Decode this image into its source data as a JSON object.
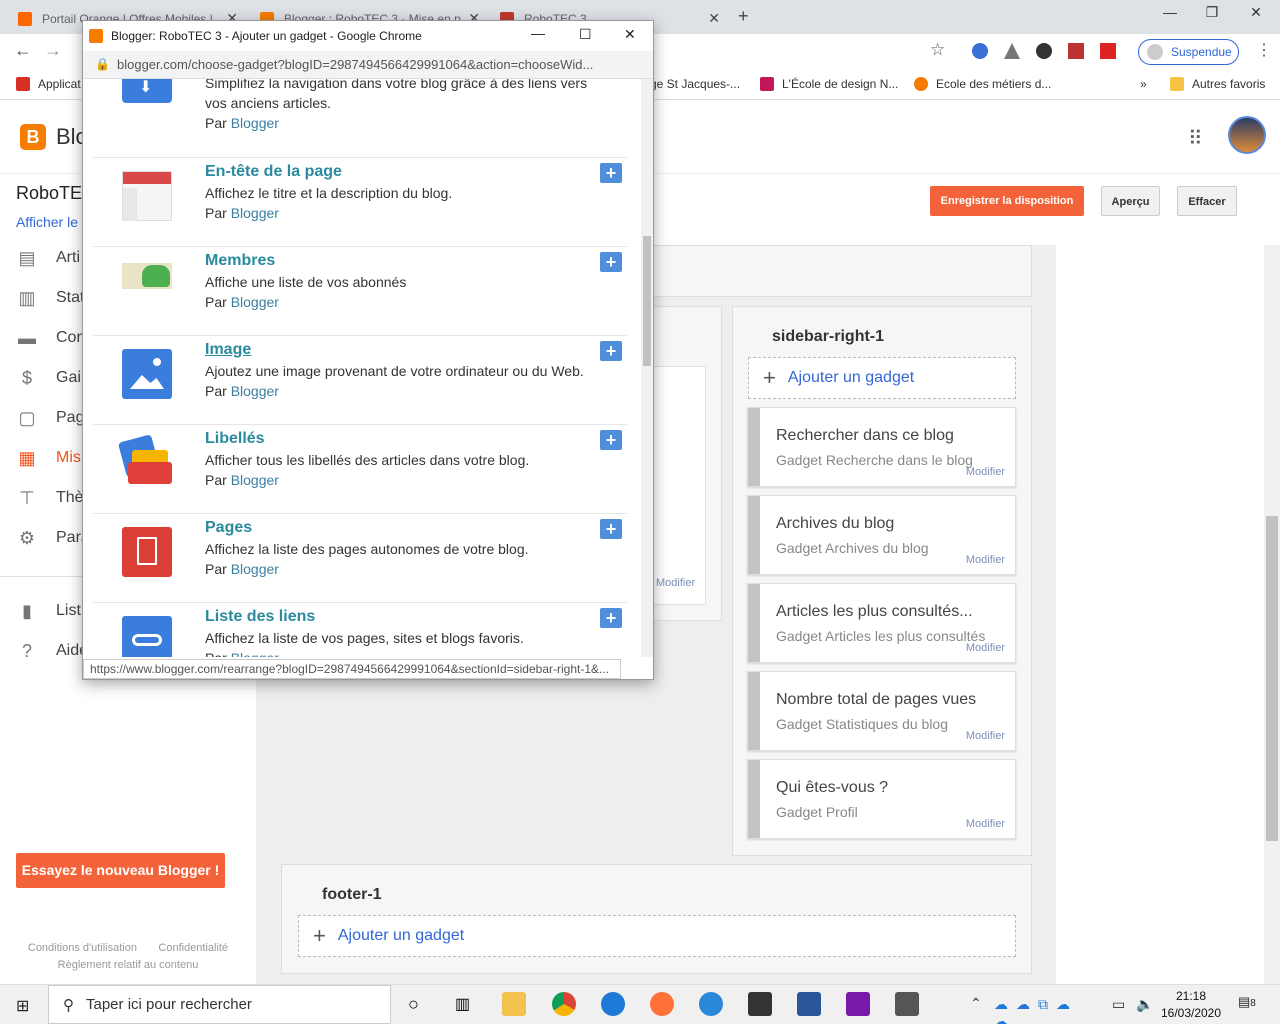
{
  "browser": {
    "tabs": [
      {
        "label": "Portail Orange | Offres Mobiles | ",
        "color": "#ff6600"
      },
      {
        "label": "Blogger : RoboTEC 3 - Mise en p",
        "color": "#f57d00"
      },
      {
        "label": "RoboTEC 3",
        "color": "#c0392b"
      }
    ],
    "profile": "Suspendue",
    "bookmarks": [
      "Applicat",
      "ge St Jacques-...",
      "L'École de design N...",
      "Ecole des métiers d...",
      "»",
      "Autres favoris"
    ]
  },
  "blogger": {
    "brand": "Blo",
    "blog_title": "RoboTEC",
    "view_blog": "Afficher le",
    "nav": [
      "Arti",
      "Stat",
      "Com",
      "Gain",
      "Pag",
      "Mis",
      "Thè",
      "Para",
      "List",
      "Aide"
    ],
    "try_new": "Essayez le nouveau Blogger !",
    "footer": {
      "terms": "Conditions d'utilisation",
      "privacy": "Confidentialité",
      "content": "Règlement relatif au contenu"
    },
    "buttons": {
      "save": "Enregistrer la disposition",
      "preview": "Aperçu",
      "clear": "Effacer"
    },
    "sidebar_title": "sidebar-right-1",
    "footer_title": "footer-1",
    "add_gadget": "Ajouter un gadget",
    "modify": "Modifier",
    "gadgets": [
      {
        "title": "Rechercher dans ce blog",
        "sub": "Gadget Recherche dans le blog"
      },
      {
        "title": "Archives du blog",
        "sub": "Gadget Archives du blog"
      },
      {
        "title": "Articles les plus consultés...",
        "sub": "Gadget Articles les plus consultés"
      },
      {
        "title": "Nombre total de pages vues",
        "sub": "Gadget Statistiques du blog"
      },
      {
        "title": "Qui êtes-vous ?",
        "sub": "Gadget Profil"
      }
    ]
  },
  "popup": {
    "title": "Blogger: RoboTEC 3 - Ajouter un gadget - Google Chrome",
    "url": "blogger.com/choose-gadget?blogID=2987494566429991064&action=chooseWid...",
    "partial_top": {
      "desc1": "Simplifiez la navigation dans votre blog grâce à des liens vers",
      "desc2": "vos anciens articles.",
      "by": "Par"
    },
    "by_label": "Par",
    "author": "Blogger",
    "items": [
      {
        "name": "En-tête de la page",
        "desc": "Affichez le titre et la description du blog."
      },
      {
        "name": "Membres",
        "desc": "Affiche une liste de vos abonnés"
      },
      {
        "name": "Image",
        "desc": "Ajoutez une image provenant de votre ordinateur ou du Web."
      },
      {
        "name": "Libellés",
        "desc": "Afficher tous les libellés des articles dans votre blog."
      },
      {
        "name": "Pages",
        "desc": "Affichez la liste des pages autonomes de votre blog."
      },
      {
        "name": "Liste des liens",
        "desc": "Affichez la liste de vos pages, sites et blogs favoris."
      }
    ],
    "status": "https://www.blogger.com/rearrange?blogID=2987494566429991064&sectionId=sidebar-right-1&..."
  },
  "taskbar": {
    "search": "Taper ici pour rechercher",
    "time": "21:18",
    "date": "16/03/2020",
    "notif": "8"
  }
}
